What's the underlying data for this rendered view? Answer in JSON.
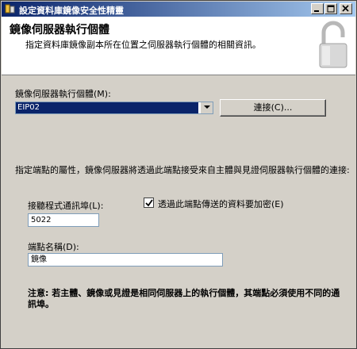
{
  "window": {
    "title": "設定資料庫鏡像安全性精靈"
  },
  "header": {
    "title": "鏡像伺服器執行個體",
    "description": "指定資料庫鏡像副本所在位置之伺服器執行個體的相關資訊。",
    "icon": "padlock-icon"
  },
  "instance": {
    "label": "鏡像伺服器執行個體(M):",
    "selected": "EIP02",
    "connect_label": "連接(C)..."
  },
  "endpoint_props_text": "指定端點的屬性，鏡像伺服器將透過此端點接受來自主體與見證伺服器執行個體的連接:",
  "port": {
    "label": "接聽程式通訊埠(L):",
    "value": "5022"
  },
  "encrypt": {
    "label": "透過此端點傳送的資料要加密(E)",
    "checked": true
  },
  "endpoint_name": {
    "label": "端點名稱(D):",
    "value": "鏡像"
  },
  "note": "注意: 若主體、鏡像或見證是相同伺服器上的執行個體，其端點必須使用不同的通訊埠。",
  "colors": {
    "title_bar": "#0a246a",
    "face": "#d4d0c8"
  }
}
